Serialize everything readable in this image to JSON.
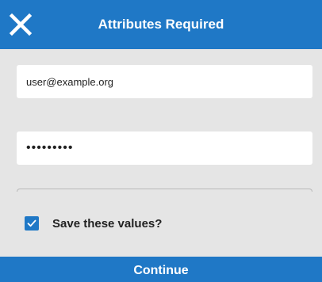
{
  "header": {
    "title": "Attributes Required",
    "close_icon": "close-icon"
  },
  "form": {
    "email_value": "user@example.org",
    "password_value": "password1",
    "save_values_label": "Save these values?",
    "save_values_checked": true
  },
  "footer": {
    "continue_label": "Continue"
  },
  "colors": {
    "accent": "#1f78c6",
    "background": "#e5e5e5",
    "field_background": "#ffffff"
  }
}
